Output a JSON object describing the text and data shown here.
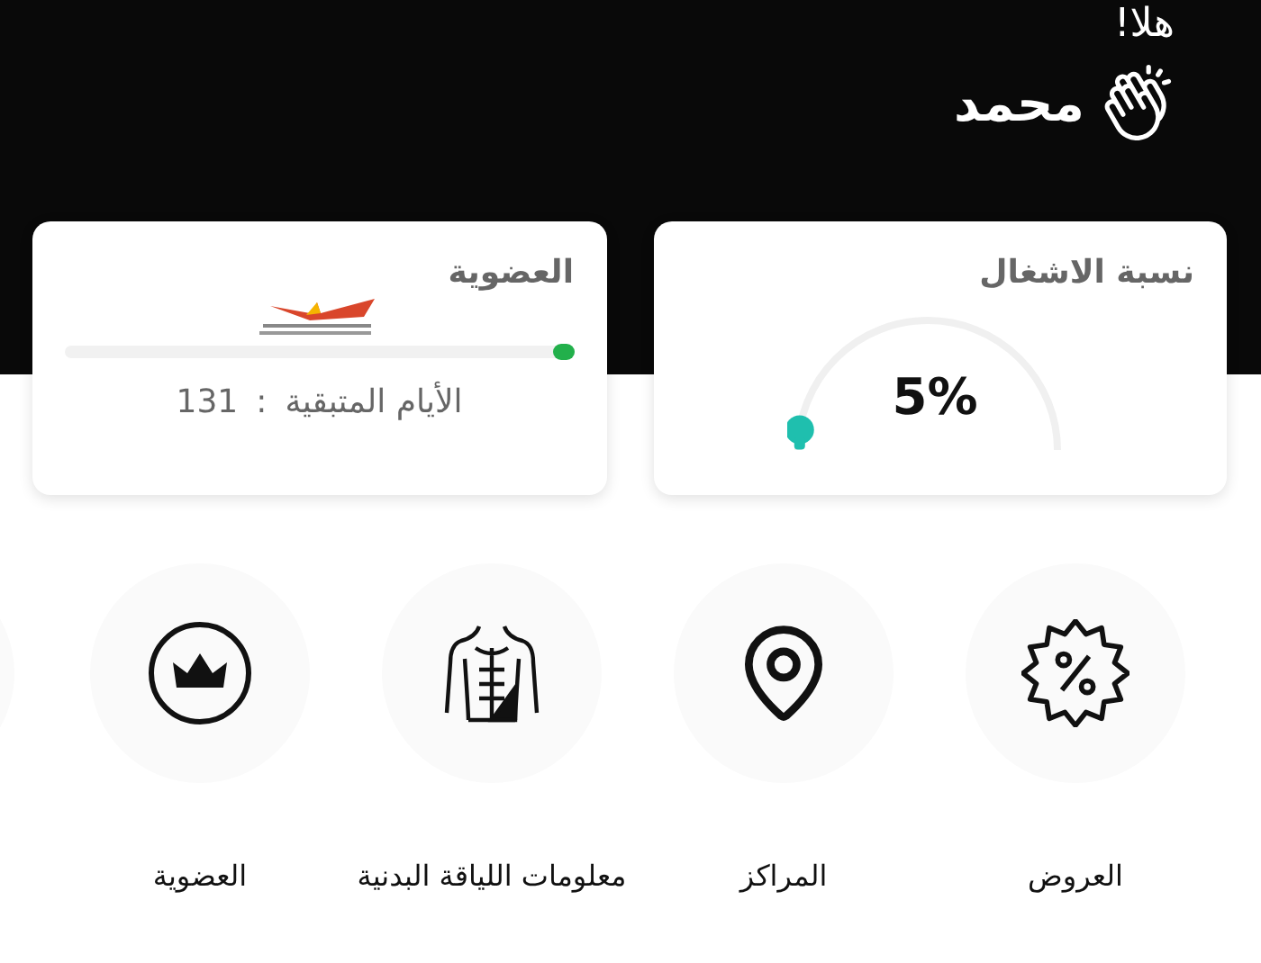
{
  "greeting": "هلا!",
  "user_name": "محمد",
  "occupancy": {
    "title": "نسبة الاشغال",
    "value": "5%",
    "level": 0.05
  },
  "membership": {
    "title": "العضوية",
    "level": 0.03,
    "days_label": "الأيام المتبقية",
    "days_separator": ":",
    "days_value": "131"
  },
  "menu": [
    {
      "kind": "offers",
      "label": "العروض"
    },
    {
      "kind": "centers",
      "label": "المراكز"
    },
    {
      "kind": "fitness",
      "label": "معلومات اللياقة البدنية"
    },
    {
      "kind": "membership",
      "label": "العضوية"
    }
  ]
}
